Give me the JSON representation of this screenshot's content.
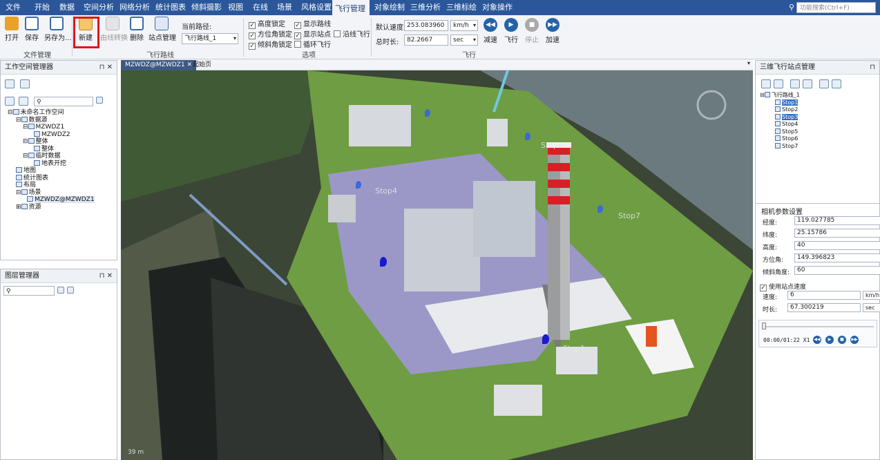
{
  "menu": {
    "tabs": [
      "文件",
      "开始",
      "数据",
      "空间分析",
      "网络分析",
      "统计图表",
      "倾斜摄影",
      "视图",
      "在线",
      "场景",
      "风格设置",
      "飞行管理",
      "对象绘制",
      "三维分析",
      "三维标绘",
      "对象操作"
    ],
    "active_tab": "飞行管理",
    "search_placeholder": "功能搜索(Ctrl+F)"
  },
  "ribbon": {
    "file_group": {
      "label": "文件管理",
      "open": "打开",
      "save": "保存",
      "save_as": "另存为..."
    },
    "route_group": {
      "label": "飞行路线",
      "new": "新建",
      "convert": "由线转换",
      "delete": "删除",
      "stop_manage": "站点管理",
      "current_path_label": "当前路径:",
      "current_path_value": "飞行路线_1"
    },
    "options_group": {
      "label": "选项",
      "height_lock": "高度锁定",
      "show_route": "显示路线",
      "azimuth_lock": "方位角锁定",
      "show_stops": "显示站点",
      "along_line": "沿线飞行",
      "tilt_lock": "倾斜角锁定",
      "loop_flight": "循环飞行"
    },
    "flight_group": {
      "label": "飞行",
      "default_speed_label": "默认速度:",
      "default_speed_value": "253.083960",
      "speed_unit": "km/h",
      "total_time_label": "总时长:",
      "total_time_value": "82.2667",
      "time_unit": "sec",
      "decelerate": "减速",
      "fly": "飞行",
      "stop": "停止",
      "accelerate": "加速"
    }
  },
  "workspace": {
    "title": "工作空间管理器",
    "tree": [
      "未命名工作空间",
      "数据源",
      "MZWDZ1",
      "MZWDZ2",
      "整体",
      "整体",
      "临时数据",
      "地表开挖",
      "地图",
      "统计图表",
      "布局",
      "场景",
      "MZWDZ@MZWDZ1",
      "资源"
    ]
  },
  "layers": {
    "title": "图层管理器"
  },
  "doc_tabs": {
    "active": "MZWDZ@MZWDZ1",
    "other": "起始页"
  },
  "scene": {
    "stop_labels": [
      "Stop6",
      "Stop4",
      "Stop7",
      "Stop1"
    ],
    "scale": "39 m"
  },
  "stop_manager": {
    "title": "三维飞行站点管理",
    "route": "飞行路线_1",
    "stops": [
      "Stop1",
      "Stop2",
      "Stop3",
      "Stop4",
      "Stop5",
      "Stop6",
      "Stop7"
    ],
    "selected": [
      "Stop1",
      "Stop3"
    ]
  },
  "camera": {
    "title": "相机参数设置",
    "longitude_label": "经度:",
    "longitude": "119.027785",
    "latitude_label": "纬度:",
    "latitude": "25.15786",
    "altitude_label": "高度:",
    "altitude": "40",
    "azimuth_label": "方位角:",
    "azimuth": "149.396823",
    "tilt_label": "倾斜角度:",
    "tilt": "60",
    "use_stop_speed": "使用站点速度",
    "speed_label": "速度:",
    "speed": "6",
    "speed_unit": "km/h",
    "duration_label": "时长:",
    "duration": "67.300219",
    "duration_unit": "sec",
    "playback_time": "00:00/01:22 X1"
  },
  "colors": {
    "menubar": "#2b579a",
    "highlight": "#e0151b",
    "accent": "#2563a8"
  }
}
